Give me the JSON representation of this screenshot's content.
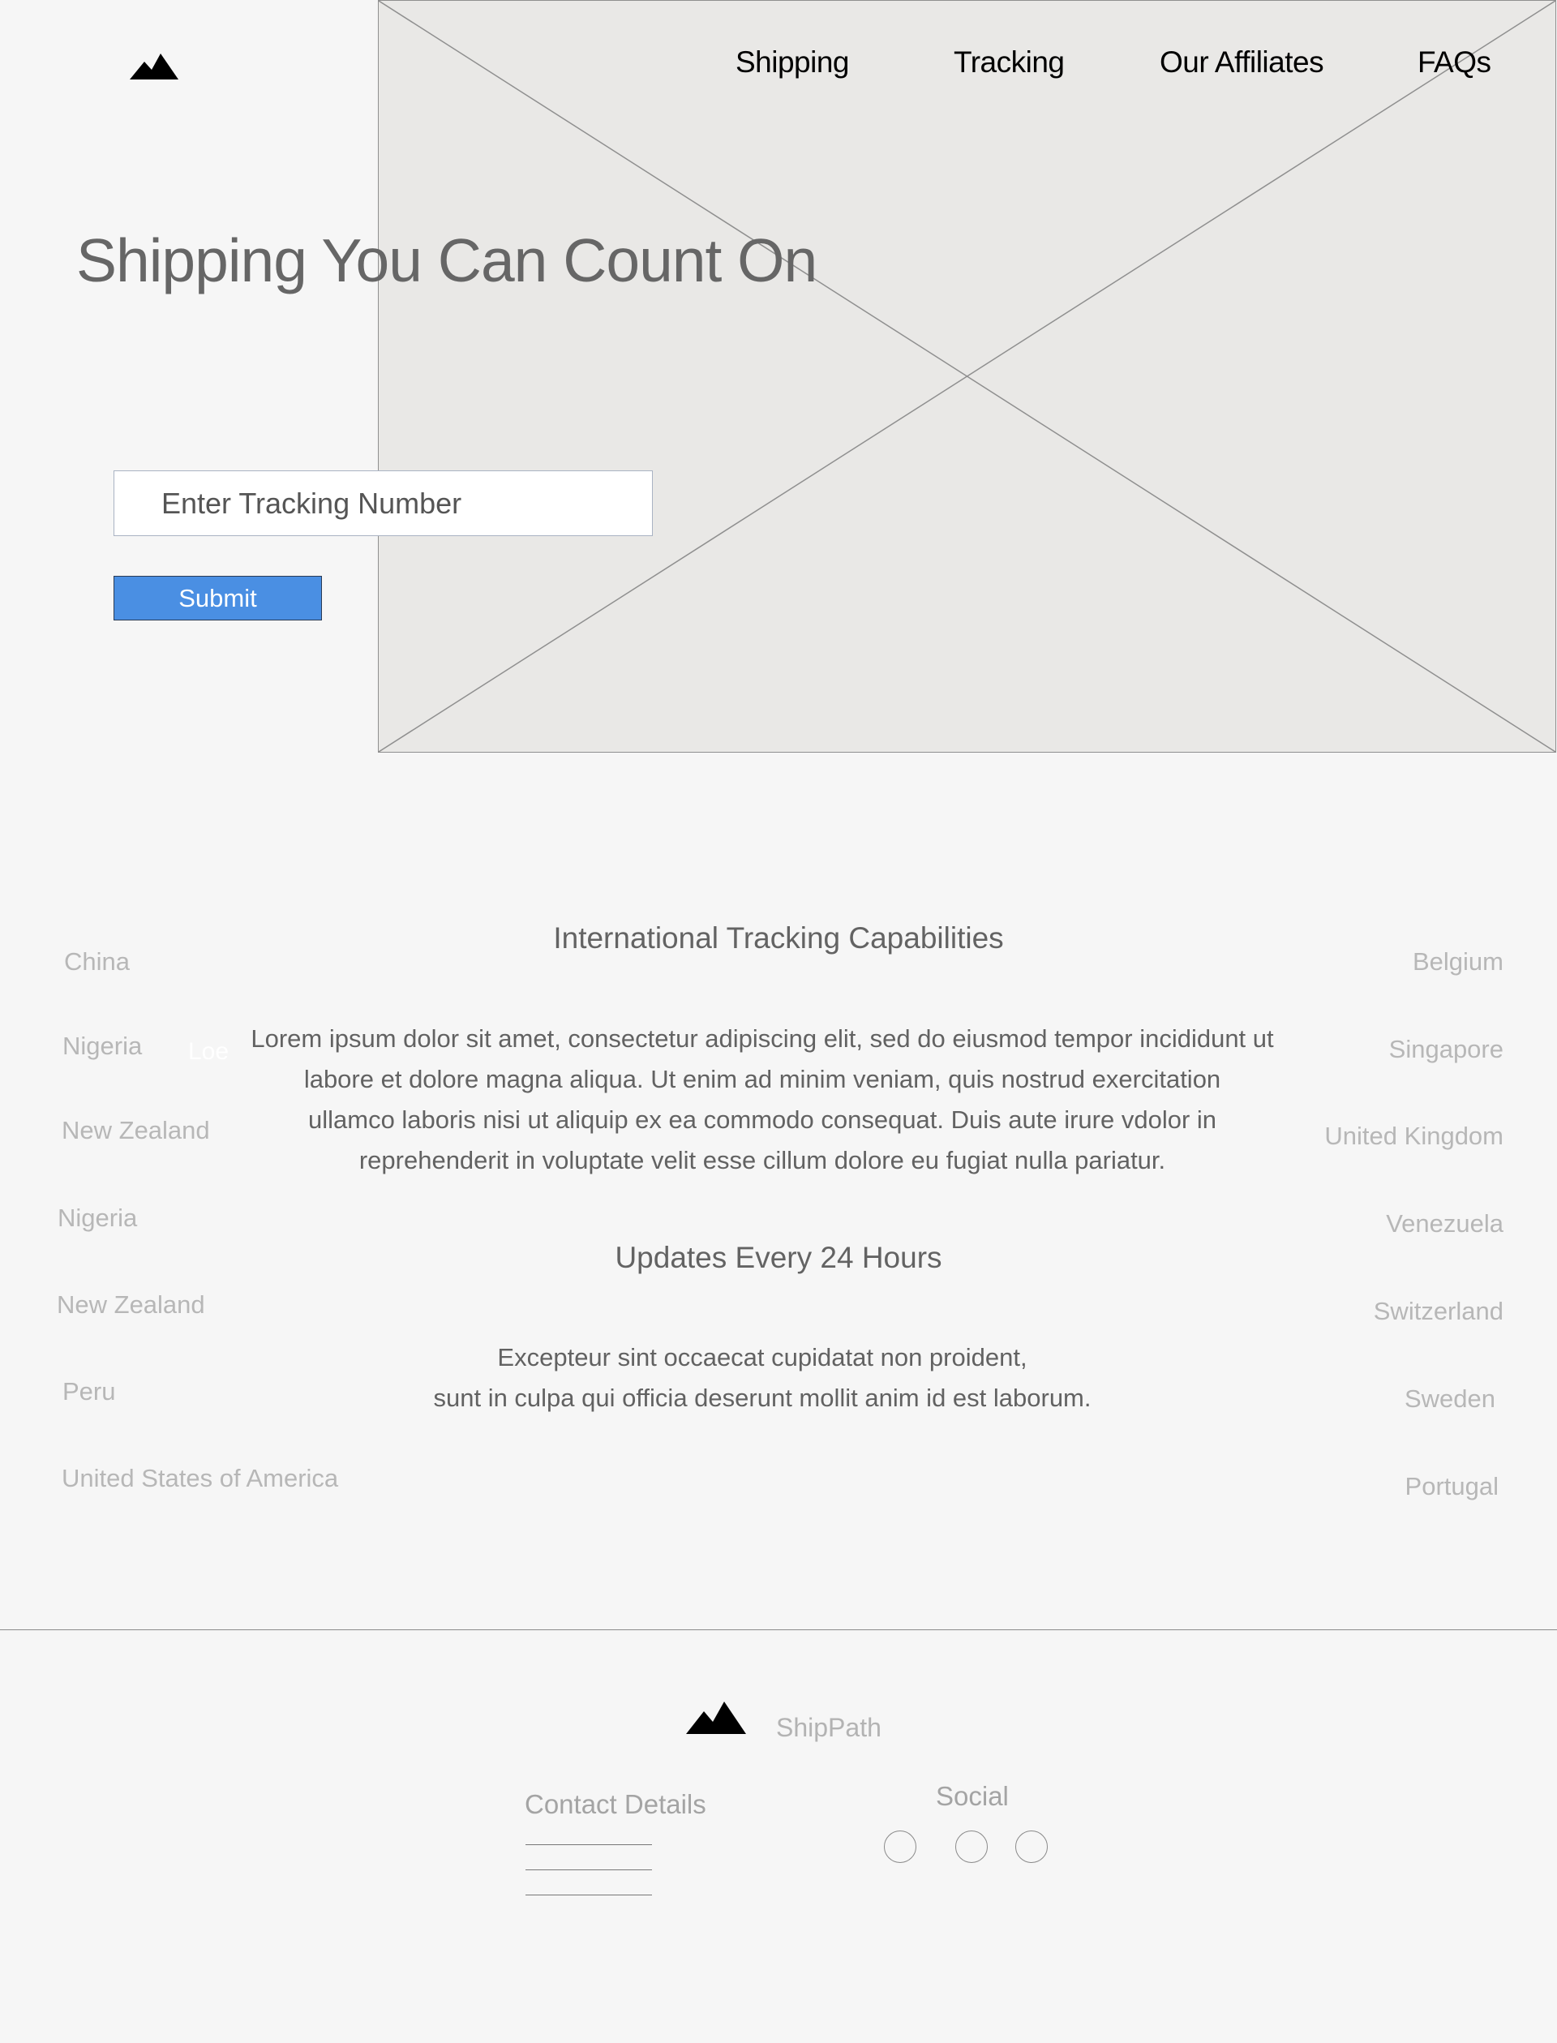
{
  "nav": {
    "items": [
      {
        "label": "Shipping"
      },
      {
        "label": "Tracking"
      },
      {
        "label": "Our Affiliates"
      },
      {
        "label": "FAQs"
      }
    ]
  },
  "hero": {
    "title": "Shipping You Can Count On",
    "tracking_placeholder": "Enter Tracking Number",
    "submit_label": "Submit"
  },
  "countries_left": [
    "China",
    "Nigeria",
    "New Zealand",
    "Nigeria",
    "New Zealand",
    "Peru",
    "United States of America"
  ],
  "countries_right": [
    "Belgium",
    "Singapore",
    "United Kingdom",
    "Venezuela",
    "Switzerland",
    "Sweden",
    "Portugal"
  ],
  "ghost_text": "Loe",
  "section_international": {
    "heading": "International Tracking Capabilities",
    "lines": [
      "Lorem ipsum dolor sit amet, consectetur adipiscing elit, sed do eiusmod tempor incididunt ut",
      "labore et dolore magna aliqua. Ut enim ad minim veniam, quis nostrud exercitation",
      "ullamco laboris nisi ut aliquip ex ea commodo consequat. Duis aute irure vdolor in",
      "reprehenderit in voluptate velit esse cillum dolore eu fugiat nulla pariatur."
    ]
  },
  "section_updates": {
    "heading": "Updates Every 24 Hours",
    "lines": [
      "Excepteur sint occaecat cupidatat non proident,",
      "sunt in culpa qui officia deserunt mollit anim id est laborum."
    ]
  },
  "footer": {
    "brand": "ShipPath",
    "contact_heading": "Contact Details",
    "social_heading": "Social"
  },
  "colors": {
    "page_bg": "#f6f6f6",
    "placeholder_bg": "#e9e8e6",
    "accent_button": "#4a8fe3"
  },
  "icons": [
    "mountain-logo-icon",
    "image-placeholder-icon",
    "social-icon"
  ]
}
